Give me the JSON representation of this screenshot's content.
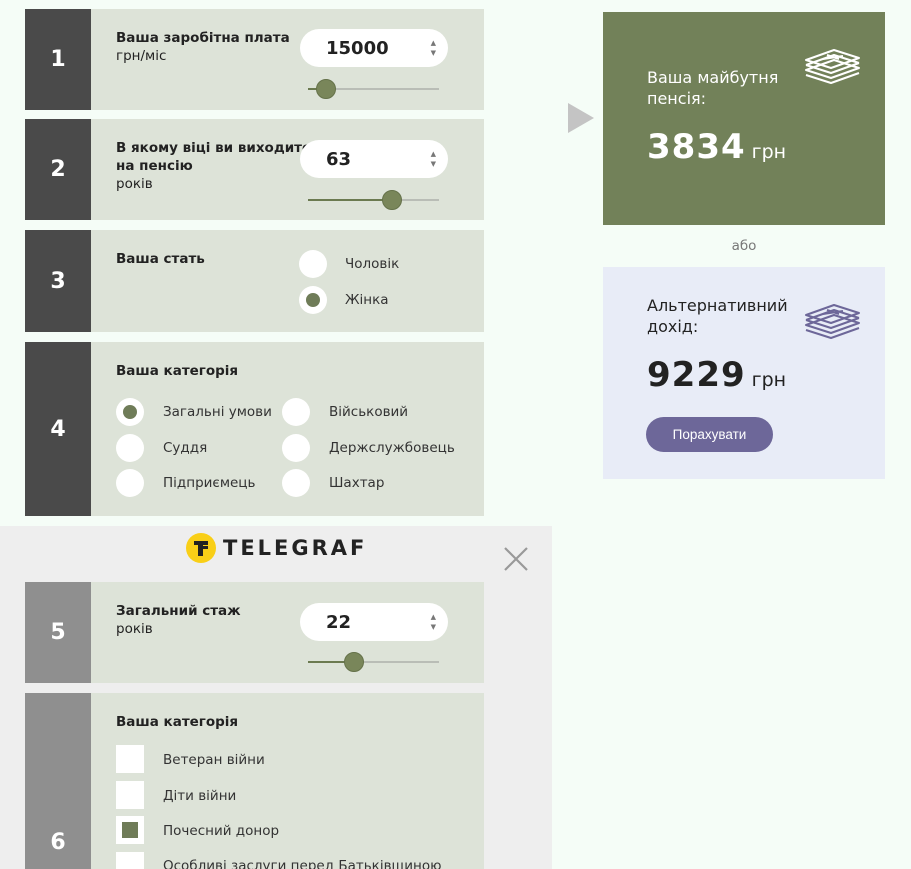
{
  "questions": {
    "salary": {
      "number": "1",
      "title": "Ваша заробітна плата",
      "unit": "грн/міс",
      "value": "15000",
      "slider_level": 0.14
    },
    "retirement_age": {
      "number": "2",
      "title_line1": "В якому віці ви виходите",
      "title_line2": "на пенсію",
      "unit": "років",
      "value": "63",
      "slider_level": 0.64
    },
    "gender": {
      "number": "3",
      "title": "Ваша стать",
      "options": [
        {
          "label": "Чоловік",
          "selected": false
        },
        {
          "label": "Жінка",
          "selected": true
        }
      ]
    },
    "category": {
      "number": "4",
      "title": "Ваша категорія",
      "options": [
        {
          "label": "Загальні умови",
          "selected": true
        },
        {
          "label": "Військовий",
          "selected": false
        },
        {
          "label": "Суддя",
          "selected": false
        },
        {
          "label": "Держслужбовець",
          "selected": false
        },
        {
          "label": "Підприємець",
          "selected": false
        },
        {
          "label": "Шахтар",
          "selected": false
        }
      ]
    },
    "experience": {
      "number": "5",
      "title": "Загальний стаж",
      "unit": "років",
      "value": "22",
      "slider_level": 0.36
    },
    "extra_category": {
      "number": "6",
      "title": "Ваша категорія",
      "options": [
        {
          "label": "Ветеран війни",
          "checked": false
        },
        {
          "label": "Діти війни",
          "checked": false
        },
        {
          "label": "Почесний донор",
          "checked": true
        },
        {
          "label": "Особливі заслуги перед Батьківщиною",
          "checked": false
        }
      ]
    }
  },
  "results": {
    "pension": {
      "label_line1": "Ваша майбутня",
      "label_line2": "пенсія:",
      "value": "3834",
      "unit": "грн"
    },
    "or_text": "або",
    "alternative": {
      "label_line1": "Альтернативний",
      "label_line2": "дохід:",
      "value": "9229",
      "unit": "грн"
    },
    "calculate_label": "Порахувати"
  },
  "ad": {
    "brand": "TELEGRAF"
  },
  "colors": {
    "olive": "#728159",
    "lavender_card": "#e8ecf7",
    "button_purple": "#6d6799",
    "panel_bg": "#dde3d8",
    "dark_number": "#4a4a4a",
    "logo_yellow": "#f9cf17"
  }
}
